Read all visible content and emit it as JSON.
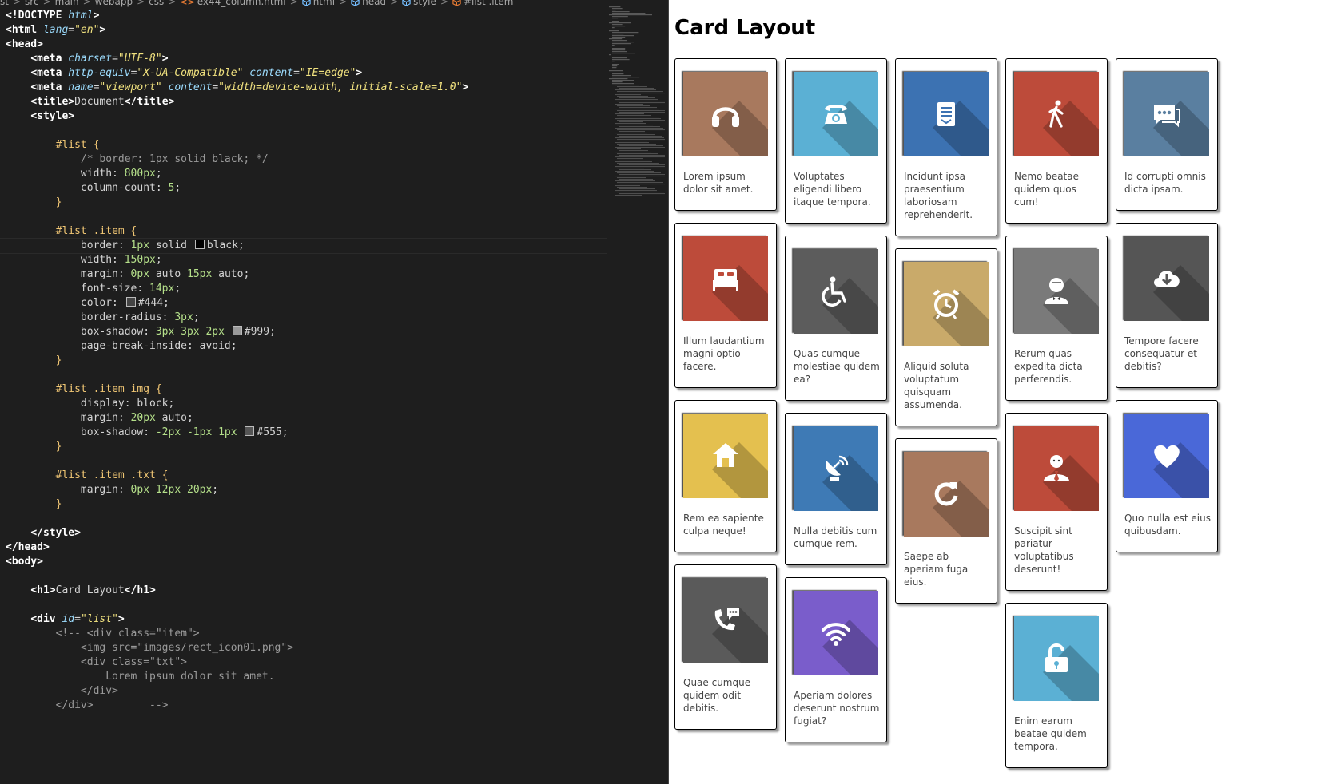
{
  "editor": {
    "breadcrumb": [
      {
        "icon": "",
        "label": "st"
      },
      {
        "icon": "",
        "label": "src"
      },
      {
        "icon": "",
        "label": "main"
      },
      {
        "icon": "",
        "label": "webapp"
      },
      {
        "icon": "",
        "label": "css"
      },
      {
        "icon": "html-file-icon",
        "label": "ex44_column.html"
      },
      {
        "icon": "element-icon",
        "label": "html"
      },
      {
        "icon": "element-icon",
        "label": "head"
      },
      {
        "icon": "element-icon",
        "label": "style"
      },
      {
        "icon": "css-selector-icon",
        "label": "#list .item"
      }
    ],
    "code_lines": [
      [
        [
          "tag",
          "<!DOCTYPE "
        ],
        [
          "attr",
          "html"
        ],
        [
          "tag",
          ">"
        ]
      ],
      [
        [
          "tag",
          "<html "
        ],
        [
          "attr",
          "lang"
        ],
        [
          "txt",
          "="
        ],
        [
          "str",
          "\"en\""
        ],
        [
          "tag",
          ">"
        ]
      ],
      [
        [
          "tag",
          "<head>"
        ]
      ],
      [
        [
          "txt",
          "    "
        ],
        [
          "tag",
          "<meta "
        ],
        [
          "attr",
          "charset"
        ],
        [
          "txt",
          "="
        ],
        [
          "str",
          "\"UTF-8\""
        ],
        [
          "tag",
          ">"
        ]
      ],
      [
        [
          "txt",
          "    "
        ],
        [
          "tag",
          "<meta "
        ],
        [
          "attr",
          "http-equiv"
        ],
        [
          "txt",
          "="
        ],
        [
          "str",
          "\"X-UA-Compatible\""
        ],
        [
          "txt",
          " "
        ],
        [
          "attr",
          "content"
        ],
        [
          "txt",
          "="
        ],
        [
          "str",
          "\"IE=edge\""
        ],
        [
          "tag",
          ">"
        ]
      ],
      [
        [
          "txt",
          "    "
        ],
        [
          "tag",
          "<meta "
        ],
        [
          "attr",
          "name"
        ],
        [
          "txt",
          "="
        ],
        [
          "str",
          "\"viewport\""
        ],
        [
          "txt",
          " "
        ],
        [
          "attr",
          "content"
        ],
        [
          "txt",
          "="
        ],
        [
          "str",
          "\"width=device-width, initial-scale=1.0\""
        ],
        [
          "tag",
          ">"
        ]
      ],
      [
        [
          "txt",
          "    "
        ],
        [
          "tag",
          "<title>"
        ],
        [
          "txt",
          "Document"
        ],
        [
          "tag",
          "</title>"
        ]
      ],
      [
        [
          "txt",
          "    "
        ],
        [
          "tag",
          "<style>"
        ]
      ],
      [],
      [
        [
          "txt",
          "        "
        ],
        [
          "sel",
          "#list {"
        ]
      ],
      [
        [
          "txt",
          "            "
        ],
        [
          "com",
          "/* border: 1px solid black; */"
        ]
      ],
      [
        [
          "txt",
          "            "
        ],
        [
          "prop",
          "width: "
        ],
        [
          "num",
          "800px"
        ],
        [
          "txt",
          ";"
        ]
      ],
      [
        [
          "txt",
          "            "
        ],
        [
          "prop",
          "column-count: "
        ],
        [
          "num",
          "5"
        ],
        [
          "txt",
          ";"
        ]
      ],
      [
        [
          "txt",
          "        "
        ],
        [
          "sel",
          "}"
        ]
      ],
      [],
      [
        [
          "txt",
          "        "
        ],
        [
          "sel",
          "#list .item {"
        ]
      ],
      [
        [
          "txt",
          "            "
        ],
        [
          "prop",
          "border: "
        ],
        [
          "num",
          "1px"
        ],
        [
          "txt",
          " solid "
        ],
        [
          "swatch",
          "#000000"
        ],
        [
          "txt",
          "black;"
        ]
      ],
      [
        [
          "txt",
          "            "
        ],
        [
          "prop",
          "width: "
        ],
        [
          "num",
          "150px"
        ],
        [
          "txt",
          ";"
        ]
      ],
      [
        [
          "txt",
          "            "
        ],
        [
          "prop",
          "margin: "
        ],
        [
          "num",
          "0px"
        ],
        [
          "txt",
          " auto "
        ],
        [
          "num",
          "15px"
        ],
        [
          "txt",
          " auto;"
        ]
      ],
      [
        [
          "txt",
          "            "
        ],
        [
          "prop",
          "font-size: "
        ],
        [
          "num",
          "14px"
        ],
        [
          "txt",
          ";"
        ]
      ],
      [
        [
          "txt",
          "            "
        ],
        [
          "prop",
          "color: "
        ],
        [
          "swatch",
          "#444444"
        ],
        [
          "txt",
          "#444;"
        ]
      ],
      [
        [
          "txt",
          "            "
        ],
        [
          "prop",
          "border-radius: "
        ],
        [
          "num",
          "3px"
        ],
        [
          "txt",
          ";"
        ]
      ],
      [
        [
          "txt",
          "            "
        ],
        [
          "prop",
          "box-shadow: "
        ],
        [
          "num",
          "3px 3px 2px"
        ],
        [
          "txt",
          " "
        ],
        [
          "swatch",
          "#999999"
        ],
        [
          "txt",
          "#999;"
        ]
      ],
      [
        [
          "txt",
          "            "
        ],
        [
          "prop",
          "page-break-inside: avoid;"
        ]
      ],
      [
        [
          "txt",
          "        "
        ],
        [
          "sel",
          "}"
        ]
      ],
      [],
      [
        [
          "txt",
          "        "
        ],
        [
          "sel",
          "#list .item img {"
        ]
      ],
      [
        [
          "txt",
          "            "
        ],
        [
          "prop",
          "display: block;"
        ]
      ],
      [
        [
          "txt",
          "            "
        ],
        [
          "prop",
          "margin: "
        ],
        [
          "num",
          "20px"
        ],
        [
          "txt",
          " auto;"
        ]
      ],
      [
        [
          "txt",
          "            "
        ],
        [
          "prop",
          "box-shadow: "
        ],
        [
          "num",
          "-2px -1px 1px"
        ],
        [
          "txt",
          " "
        ],
        [
          "swatch",
          "#555555"
        ],
        [
          "txt",
          "#555;"
        ]
      ],
      [
        [
          "txt",
          "        "
        ],
        [
          "sel",
          "}"
        ]
      ],
      [],
      [
        [
          "txt",
          "        "
        ],
        [
          "sel",
          "#list .item .txt {"
        ]
      ],
      [
        [
          "txt",
          "            "
        ],
        [
          "prop",
          "margin: "
        ],
        [
          "num",
          "0px 12px 20px"
        ],
        [
          "txt",
          ";"
        ]
      ],
      [
        [
          "txt",
          "        "
        ],
        [
          "sel",
          "}"
        ]
      ],
      [],
      [
        [
          "txt",
          "    "
        ],
        [
          "tag",
          "</style>"
        ]
      ],
      [
        [
          "tag",
          "</head>"
        ]
      ],
      [
        [
          "tag",
          "<body>"
        ]
      ],
      [],
      [
        [
          "txt",
          "    "
        ],
        [
          "tag",
          "<h1>"
        ],
        [
          "txt",
          "Card Layout"
        ],
        [
          "tag",
          "</h1>"
        ]
      ],
      [],
      [
        [
          "txt",
          "    "
        ],
        [
          "tag",
          "<div "
        ],
        [
          "attr",
          "id"
        ],
        [
          "txt",
          "="
        ],
        [
          "str",
          "\"list\""
        ],
        [
          "tag",
          ">"
        ]
      ],
      [
        [
          "txt",
          "        "
        ],
        [
          "com",
          "<!-- <div class=\"item\">"
        ]
      ],
      [
        [
          "txt",
          "            "
        ],
        [
          "com",
          "<img src=\"images/rect_icon01.png\">"
        ]
      ],
      [
        [
          "txt",
          "            "
        ],
        [
          "com",
          "<div class=\"txt\">"
        ]
      ],
      [
        [
          "txt",
          "                "
        ],
        [
          "com",
          "Lorem ipsum dolor sit amet."
        ]
      ],
      [
        [
          "txt",
          "            "
        ],
        [
          "com",
          "</div>"
        ]
      ],
      [
        [
          "txt",
          "        "
        ],
        [
          "com",
          "</div>         -->"
        ]
      ]
    ]
  },
  "preview": {
    "title": "Card Layout",
    "columns": [
      [
        {
          "icon": "headphones-icon",
          "color": "#a8795e",
          "text": "Lorem ipsum dolor sit amet."
        },
        {
          "icon": "bed-icon",
          "color": "#bd4b3a",
          "text": "Illum laudantium magni optio facere."
        },
        {
          "icon": "home-icon",
          "color": "#e4c04f",
          "text": "Rem ea sapiente culpa neque!"
        },
        {
          "icon": "phone-chat-icon",
          "color": "#5a5a5a",
          "text": "Quae cumque quidem odit debitis."
        }
      ],
      [
        {
          "icon": "telephone-icon",
          "color": "#5bb0d4",
          "text": "Voluptates eligendi libero itaque tempora."
        },
        {
          "icon": "wheelchair-icon",
          "color": "#5c5c5c",
          "text": "Quas cumque molestiae quidem ea?"
        },
        {
          "icon": "satellite-dish-icon",
          "color": "#3e7ab5",
          "text": "Nulla debitis cum cumque rem."
        },
        {
          "icon": "wifi-icon",
          "color": "#7a5dcb",
          "text": "Aperiam dolores deserunt nostrum fugiat?"
        }
      ],
      [
        {
          "icon": "document-icon",
          "color": "#3c72b2",
          "text": "Incidunt ipsa praesentium laboriosam reprehenderit."
        },
        {
          "icon": "alarm-clock-icon",
          "color": "#c9aa6a",
          "text": "Aliquid soluta voluptatum quisquam assumenda."
        },
        {
          "icon": "refresh-icon",
          "color": "#a8795e",
          "text": "Saepe ab aperiam fuga eius."
        }
      ],
      [
        {
          "icon": "walking-person-icon",
          "color": "#bd4b3a",
          "text": "Nemo beatae quidem quos cum!"
        },
        {
          "icon": "waiter-icon",
          "color": "#7a7a7a",
          "text": "Rerum quas expedita dicta perferendis."
        },
        {
          "icon": "businessman-icon",
          "color": "#bd4b3a",
          "text": "Suscipit sint pariatur voluptatibus deserunt!"
        },
        {
          "icon": "unlock-icon",
          "color": "#5bb0d4",
          "text": "Enim earum beatae quidem tempora."
        }
      ],
      [
        {
          "icon": "chat-bubble-icon",
          "color": "#5a7fa0",
          "text": "Id corrupti omnis dicta ipsam."
        },
        {
          "icon": "cloud-download-icon",
          "color": "#555555",
          "text": "Tempore facere consequatur et debitis?"
        },
        {
          "icon": "heart-icon",
          "color": "#4a68d8",
          "text": "Quo nulla est eius quibusdam."
        }
      ]
    ]
  }
}
